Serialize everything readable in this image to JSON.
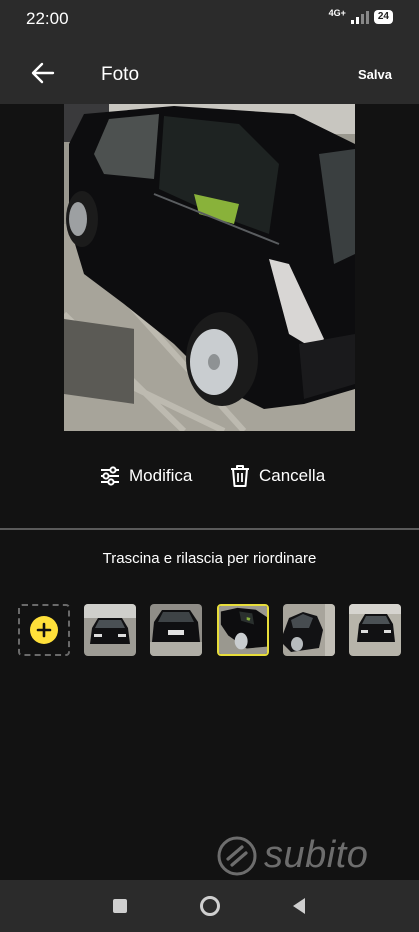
{
  "status_bar": {
    "time": "22:00",
    "network": "4G+",
    "battery": "24"
  },
  "app_bar": {
    "title": "Foto",
    "save_label": "Salva",
    "back_icon": "arrow-left-icon"
  },
  "main_photo": {
    "description_icon": "car-photo"
  },
  "actions": {
    "edit_label": "Modifica",
    "edit_icon": "sliders-icon",
    "delete_label": "Cancella",
    "delete_icon": "trash-icon"
  },
  "hint": "Trascina e rilascia per riordinare",
  "thumbnails": {
    "add_icon": "plus-icon",
    "count": 6,
    "selected_index": 3
  },
  "watermark": {
    "text": "subito"
  },
  "colors": {
    "accent_yellow": "#ffe03a",
    "selected_border": "#e7dd3a",
    "background": "#121212",
    "bar": "#2b2b2b"
  }
}
